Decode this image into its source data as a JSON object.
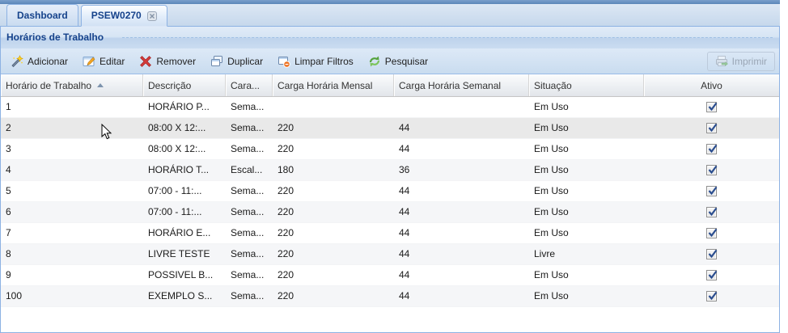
{
  "tabs": [
    {
      "label": "Dashboard",
      "active": false,
      "closable": false
    },
    {
      "label": "PSEW0270",
      "active": true,
      "closable": true
    }
  ],
  "panel_title": "Horários de Trabalho",
  "toolbar": {
    "buttons": [
      {
        "label": "Adicionar",
        "icon": "wand-add-icon"
      },
      {
        "label": "Editar",
        "icon": "edit-pencil-icon"
      },
      {
        "label": "Remover",
        "icon": "remove-cross-icon"
      },
      {
        "label": "Duplicar",
        "icon": "duplicate-windows-icon"
      },
      {
        "label": "Limpar Filtros",
        "icon": "clear-filters-icon"
      },
      {
        "label": "Pesquisar",
        "icon": "refresh-search-icon"
      }
    ],
    "right_button": {
      "label": "Imprimir",
      "icon": "printer-icon",
      "disabled": true
    }
  },
  "grid": {
    "columns": [
      {
        "label": "Horário de Trabalho",
        "sort": "asc"
      },
      {
        "label": "Descrição"
      },
      {
        "label": "Cara..."
      },
      {
        "label": "Carga Horária Mensal"
      },
      {
        "label": "Carga Horária Semanal"
      },
      {
        "label": "Situação"
      },
      {
        "label": "Ativo",
        "align": "center",
        "type": "checkbox"
      }
    ],
    "rows": [
      {
        "cells": [
          "1",
          "HORÁRIO P...",
          "Sema...",
          "",
          "",
          "Em Uso"
        ],
        "ativo": true,
        "hover": false
      },
      {
        "cells": [
          "2",
          "08:00 X 12:...",
          "Sema...",
          "220",
          "44",
          "Em Uso"
        ],
        "ativo": true,
        "hover": true
      },
      {
        "cells": [
          "3",
          "08:00 X 12:...",
          "Sema...",
          "220",
          "44",
          "Em Uso"
        ],
        "ativo": true,
        "hover": false
      },
      {
        "cells": [
          "4",
          "HORÁRIO T...",
          "Escal...",
          "180",
          "36",
          "Em Uso"
        ],
        "ativo": true,
        "hover": false
      },
      {
        "cells": [
          "5",
          "07:00 - 11:...",
          "Sema...",
          "220",
          "44",
          "Em Uso"
        ],
        "ativo": true,
        "hover": false
      },
      {
        "cells": [
          "6",
          "07:00 - 11:...",
          "Sema...",
          "220",
          "44",
          "Em Uso"
        ],
        "ativo": true,
        "hover": false
      },
      {
        "cells": [
          "7",
          "HORÁRIO E...",
          "Sema...",
          "220",
          "44",
          "Em Uso"
        ],
        "ativo": true,
        "hover": false
      },
      {
        "cells": [
          "8",
          "LIVRE TESTE",
          "Sema...",
          "220",
          "44",
          "Livre"
        ],
        "ativo": true,
        "hover": false
      },
      {
        "cells": [
          "9",
          "POSSIVEL B...",
          "Sema...",
          "220",
          "44",
          "Em Uso"
        ],
        "ativo": true,
        "hover": false
      },
      {
        "cells": [
          "100",
          "EXEMPLO S...",
          "Sema...",
          "220",
          "44",
          "Em Uso"
        ],
        "ativo": true,
        "hover": false
      }
    ]
  },
  "colors": {
    "accent_text": "#15428b",
    "tab_border": "#8db2e3",
    "panel_border": "#99bbe8",
    "remove_red": "#d33a3a",
    "refresh_green": "#55a33c"
  }
}
